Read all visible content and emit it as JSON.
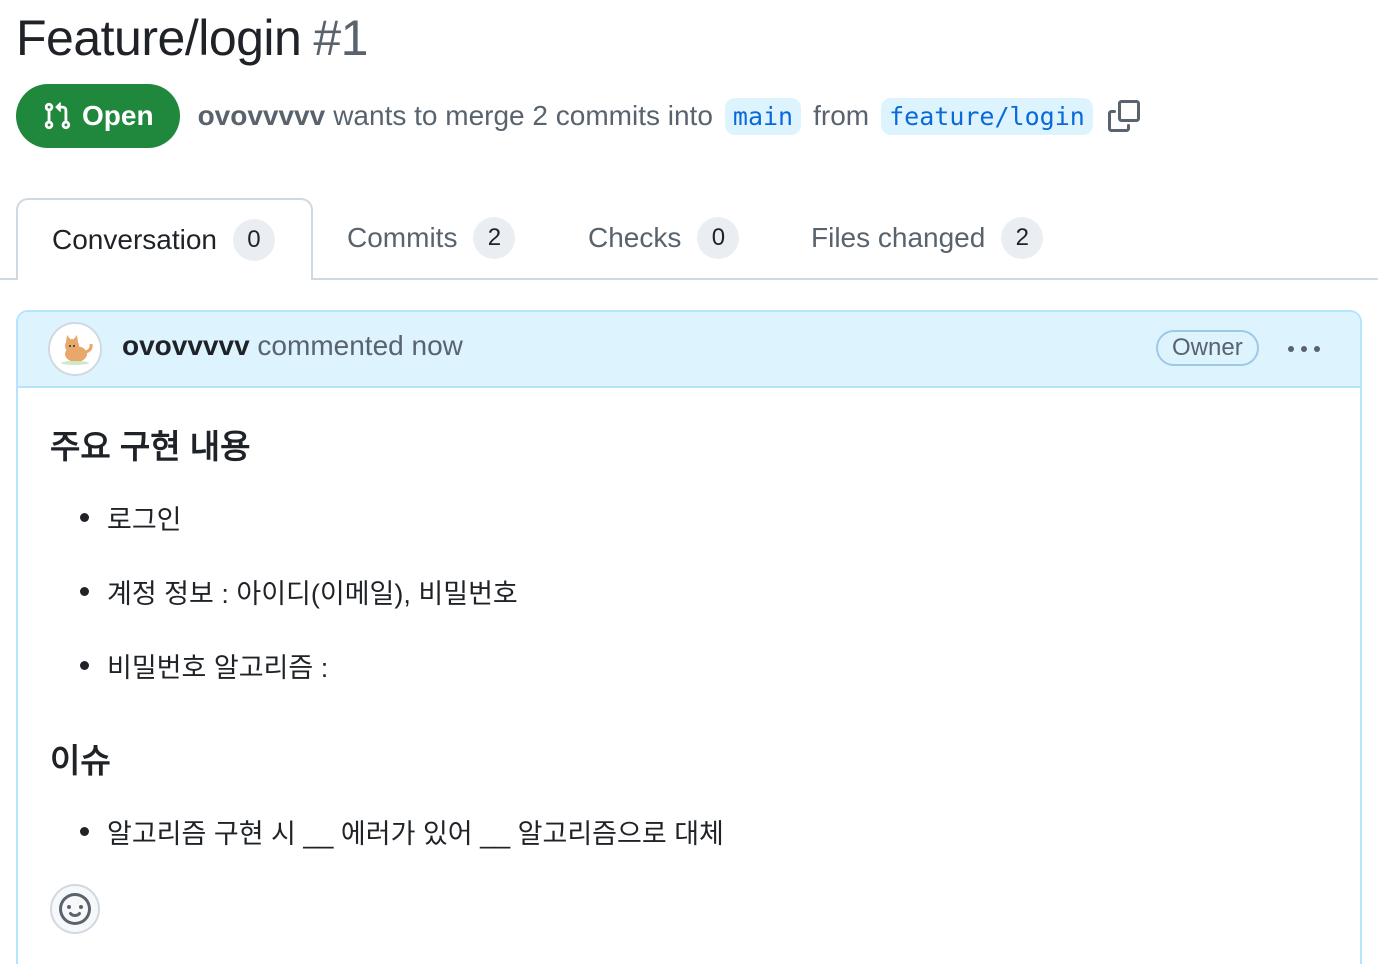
{
  "pr": {
    "title": "Feature/login",
    "number": "#1",
    "state": "Open",
    "author": "ovovvvvv",
    "merge_text_1": "wants to merge 2 commits into",
    "base_branch": "main",
    "merge_text_2": "from",
    "head_branch": "feature/login"
  },
  "tabs": [
    {
      "label": "Conversation",
      "count": "0"
    },
    {
      "label": "Commits",
      "count": "2"
    },
    {
      "label": "Checks",
      "count": "0"
    },
    {
      "label": "Files changed",
      "count": "2"
    }
  ],
  "comment": {
    "author": "ovovvvvv",
    "action": "commented now",
    "badge": "Owner",
    "sections": [
      {
        "heading": "주요 구현 내용",
        "items": [
          "로그인",
          "계정 정보 : 아이디(이메일), 비밀번호",
          "비밀번호 알고리즘 :"
        ]
      },
      {
        "heading": "이슈",
        "items": [
          "알고리즘 구현 시 __ 에러가 있어 __ 알고리즘으로 대체"
        ]
      }
    ]
  },
  "colors": {
    "open_green": "#1f883d",
    "link_blue": "#0969da",
    "header_blue": "#ddf4ff"
  }
}
